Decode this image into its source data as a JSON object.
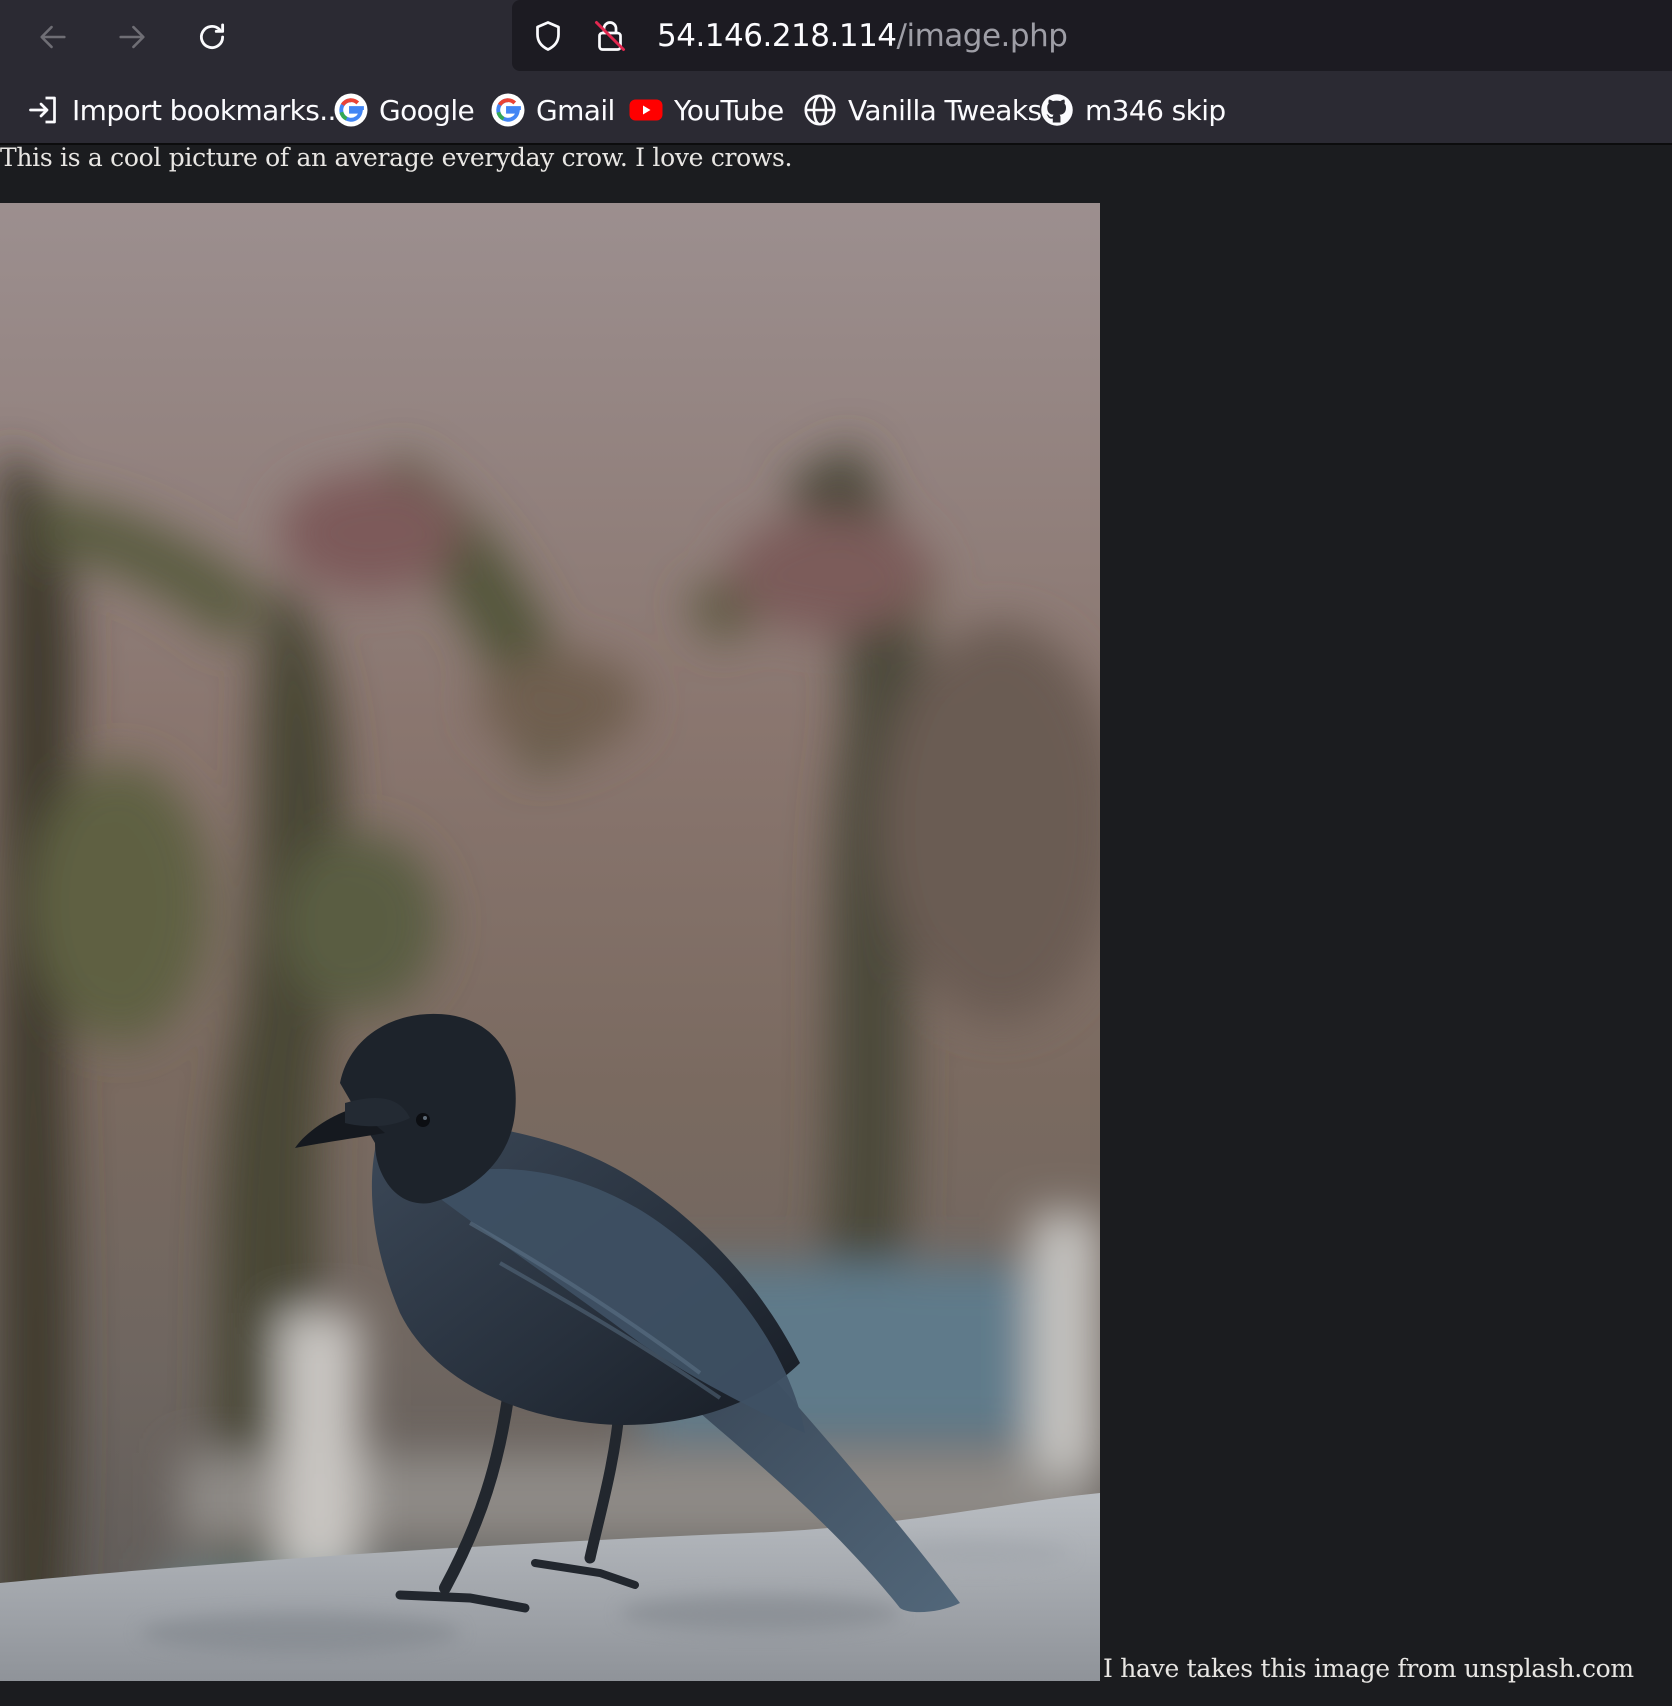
{
  "browser": {
    "url_host": "54.146.218.114",
    "url_path": "/image.php",
    "bookmarks": [
      {
        "label": "Import bookmarks...",
        "icon": "import-icon"
      },
      {
        "label": "Google",
        "icon": "google-icon"
      },
      {
        "label": "Gmail",
        "icon": "google-icon"
      },
      {
        "label": "YouTube",
        "icon": "youtube-icon"
      },
      {
        "label": "Vanilla Tweaks",
        "icon": "globe-icon"
      },
      {
        "label": "m346 skip",
        "icon": "github-icon"
      }
    ]
  },
  "page": {
    "intro_text": "This is a cool picture of an average everyday crow. I love crows.",
    "credit_text": "I have takes this image from unsplash.com"
  },
  "colors": {
    "chrome": "#2b2a33",
    "urlbar": "#1c1b22",
    "page_background": "#1b1c1f",
    "text": "#e8e6e3",
    "youtube_red": "#ff0000"
  }
}
